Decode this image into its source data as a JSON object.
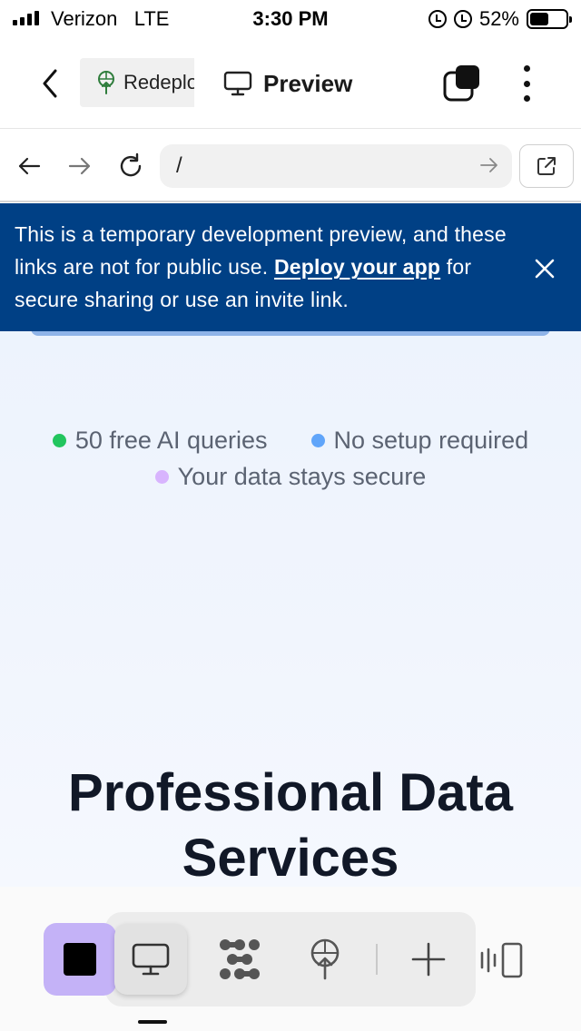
{
  "status_bar": {
    "carrier": "Verizon",
    "network": "LTE",
    "time": "3:30 PM",
    "battery": "52%",
    "battery_level": 0.52
  },
  "app_header": {
    "deploy_tab_label": "Redeploy",
    "preview_tab_label": "Preview"
  },
  "browser": {
    "url": "/"
  },
  "banner": {
    "text_before": "This is a temporary development preview, and these links are not for public use. ",
    "link_text": "Deploy your app",
    "text_after": " for secure sharing or use an invite link."
  },
  "features": {
    "items": [
      {
        "label": "50 free AI queries",
        "color": "#22c55e"
      },
      {
        "label": "No setup required",
        "color": "#60a5fa"
      },
      {
        "label": "Your data stays secure",
        "color": "#d8b4fe"
      }
    ]
  },
  "headline": {
    "text": "Professional Data Services"
  },
  "toolbar": {
    "icons": [
      "stop-icon",
      "desktop-icon",
      "chain-icon",
      "deploy-icon",
      "plus-icon",
      "side-panel-icon"
    ],
    "accent": "#c4b2f7"
  }
}
